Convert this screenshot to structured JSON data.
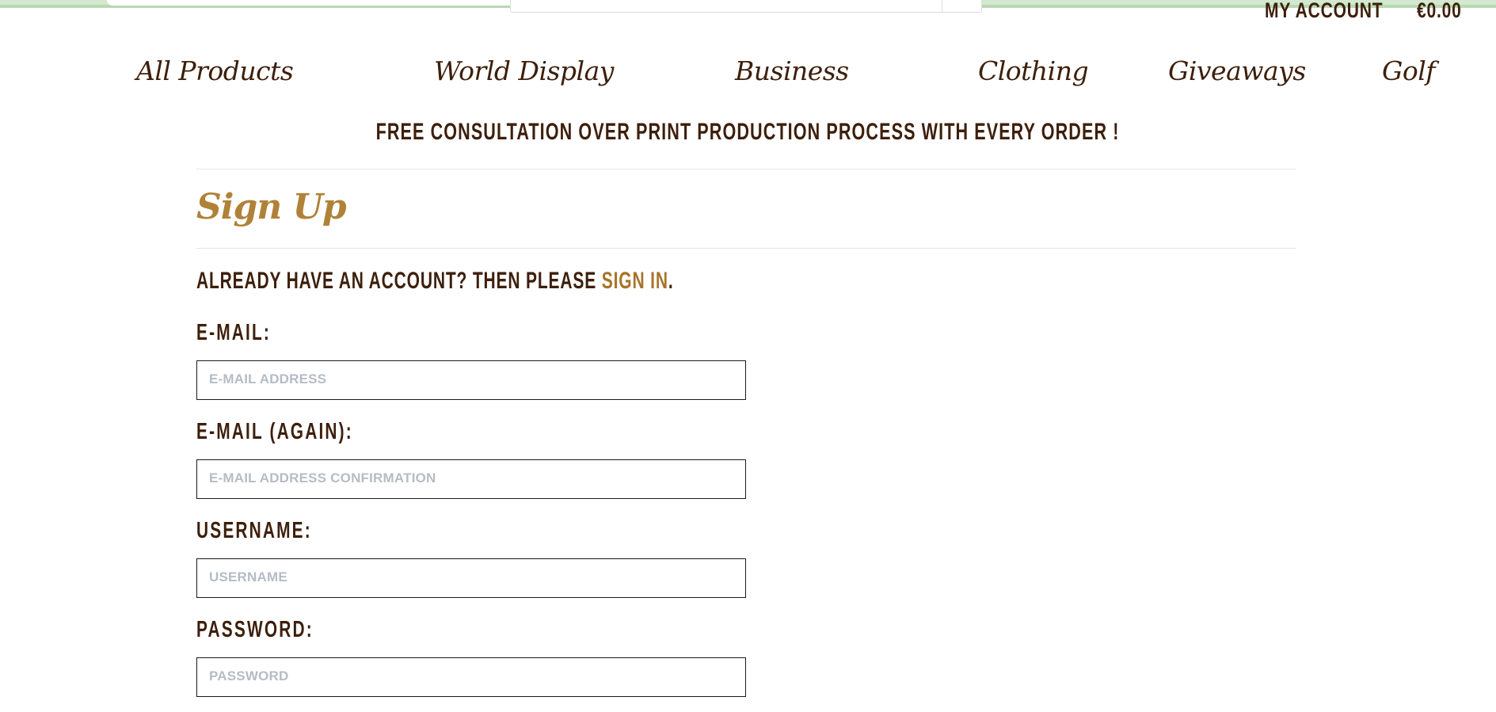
{
  "header": {
    "my_account": "MY ACCOUNT",
    "cart_total": "€0.00"
  },
  "nav": {
    "items": [
      {
        "label": "All Products"
      },
      {
        "label": "World Display"
      },
      {
        "label": "Business"
      },
      {
        "label": "Clothing"
      },
      {
        "label": "Giveaways"
      },
      {
        "label": "Golf"
      }
    ]
  },
  "promo": {
    "text": "FREE CONSULTATION OVER PRINT PRODUCTION PROCESS WITH EVERY ORDER !"
  },
  "page": {
    "title": "Sign Up",
    "already_prefix": "ALREADY HAVE AN ACCOUNT? THEN PLEASE ",
    "sign_in_link": "SIGN IN",
    "already_suffix": "."
  },
  "form": {
    "email": {
      "label": "E-MAIL:",
      "placeholder": "E-MAIL ADDRESS",
      "value": ""
    },
    "email_again": {
      "label": "E-MAIL (AGAIN):",
      "placeholder": "E-MAIL ADDRESS CONFIRMATION",
      "value": ""
    },
    "username": {
      "label": "USERNAME:",
      "placeholder": "USERNAME",
      "value": ""
    },
    "password": {
      "label": "PASSWORD:",
      "placeholder": "PASSWORD",
      "value": ""
    }
  },
  "colors": {
    "text_brown": "#3d1f0c",
    "accent_gold": "#b08238",
    "link_gold": "#a8742a",
    "placeholder_gray": "#b5bcc6",
    "topbar_green": "#b8d8b4"
  }
}
